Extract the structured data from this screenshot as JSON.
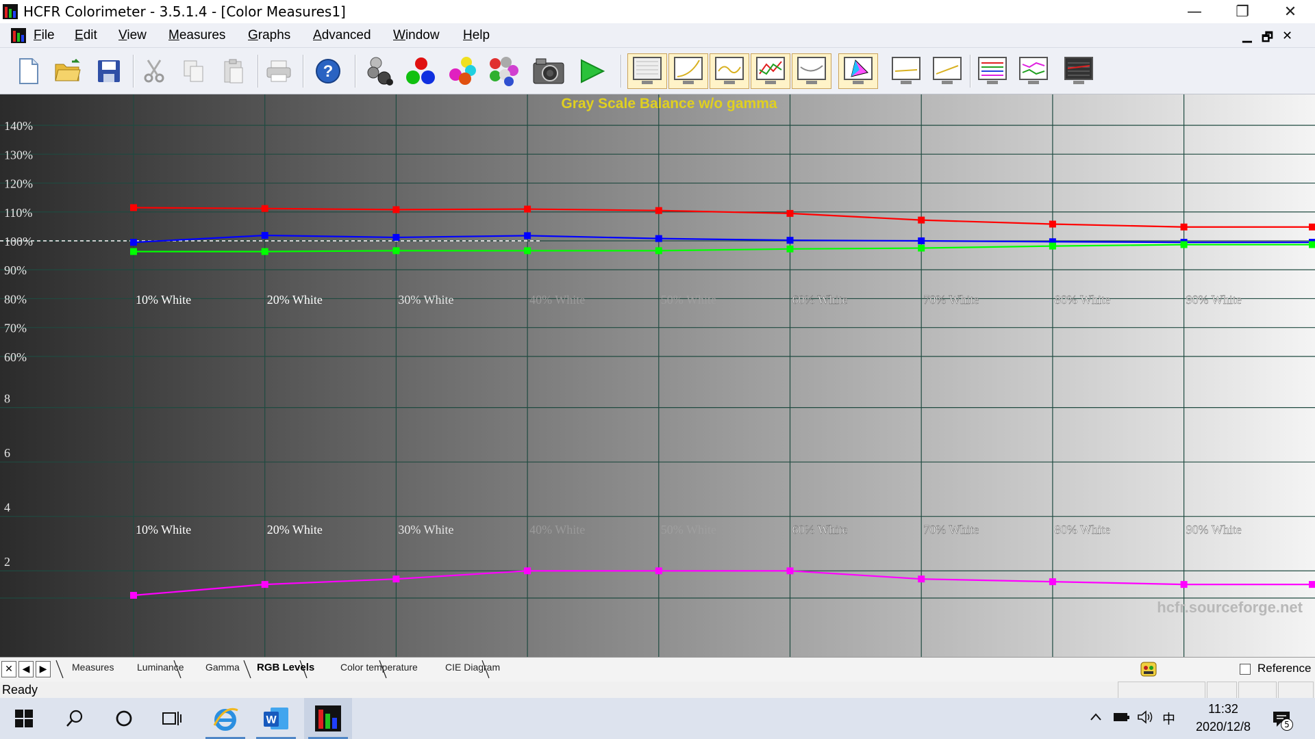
{
  "window": {
    "title": "HCFR Colorimeter - 3.5.1.4 - [Color Measures1]",
    "minimize_glyph": "—",
    "restore_glyph": "❐",
    "close_glyph": "✕"
  },
  "menu": {
    "items": [
      "File",
      "Edit",
      "View",
      "Measures",
      "Graphs",
      "Advanced",
      "Window",
      "Help"
    ],
    "mdi_minimize": "▁",
    "mdi_restore": "🗗",
    "mdi_close": "✕"
  },
  "toolbar": {
    "icons": [
      "new-document-icon",
      "open-folder-icon",
      "save-icon",
      "cut-icon",
      "copy-icon",
      "paste-icon",
      "print-icon",
      "help-icon",
      "gray-balls-icon",
      "rgb-balls-icon",
      "secondary-balls-icon",
      "multi-balls-icon",
      "camera-icon",
      "play-icon",
      "graph-monitor-icon",
      "graph-curve-icon",
      "graph-wave-icon",
      "graph-multi-icon",
      "graph-white-icon",
      "graph-cie-icon",
      "graph-line-icon",
      "graph-line2-icon",
      "graph-bars-icon",
      "graph-pink-icon",
      "graph-dark-icon"
    ]
  },
  "chart_data": {
    "type": "line",
    "title": "Gray Scale Balance w/o gamma",
    "watermark": "hcfr.sourceforge.net",
    "categories": [
      "10% White",
      "20% White",
      "30% White",
      "40% White",
      "50% White",
      "60% White",
      "70% White",
      "80% White",
      "90% White",
      "100% White"
    ],
    "top_panel": {
      "yticks": [
        "140%",
        "130%",
        "120%",
        "110%",
        "100%",
        "90%",
        "80%",
        "70%",
        "60%"
      ],
      "ylim": [
        55,
        145
      ],
      "reference": 100,
      "series": [
        {
          "color": "#ff0000",
          "values": [
            111.5,
            111.2,
            110.8,
            111.0,
            110.5,
            109.5,
            107.2,
            105.8,
            104.8,
            104.8
          ]
        },
        {
          "color": "#0000ff",
          "values": [
            99.5,
            101.9,
            101.2,
            101.8,
            100.8,
            100.2,
            100.0,
            99.7,
            99.5,
            99.5
          ]
        },
        {
          "color": "#00ff00",
          "values": [
            96.3,
            96.3,
            96.6,
            96.6,
            96.6,
            97.2,
            97.5,
            98.2,
            98.7,
            98.7
          ]
        }
      ]
    },
    "bottom_panel": {
      "yticks": [
        "8",
        "6",
        "4",
        "2"
      ],
      "ylim": [
        1,
        9.6
      ],
      "series": [
        {
          "color": "#ff00ff",
          "values": [
            1.1,
            1.5,
            1.7,
            2.0,
            2.0,
            2.0,
            1.7,
            1.6,
            1.5,
            1.5
          ]
        }
      ]
    },
    "colors": {
      "bg_dark": "#2b2b2b",
      "bg_light": "#f2f2f2",
      "grid": "#1f4a40",
      "title": "#e0d020"
    }
  },
  "tabs": {
    "nav": [
      "✕",
      "◀",
      "▶"
    ],
    "items": [
      "Measures",
      "Luminance",
      "Gamma",
      "RGB Levels",
      "Color temperature",
      "CIE Diagram"
    ],
    "active": "RGB Levels",
    "reference_label": "Reference"
  },
  "status": {
    "text": "Ready"
  },
  "taskbar": {
    "time": "11:32",
    "date": "2020/12/8",
    "ime": "中",
    "notification_count": "5"
  }
}
